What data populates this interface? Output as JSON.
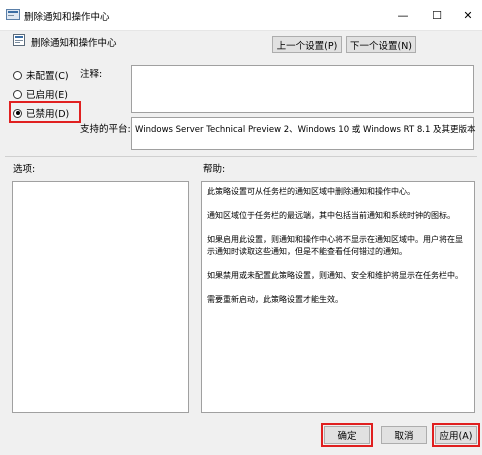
{
  "window": {
    "title": "删除通知和操作中心",
    "controls": {
      "minimize": "—",
      "maximize": "☐",
      "close": "✕"
    }
  },
  "policy": {
    "name": "删除通知和操作中心",
    "prev_label": "上一个设置(P)",
    "next_label": "下一个设置(N)"
  },
  "state": {
    "options": [
      {
        "label": "未配置(C)",
        "checked": false
      },
      {
        "label": "已启用(E)",
        "checked": false
      },
      {
        "label": "已禁用(D)",
        "checked": true
      }
    ]
  },
  "comment": {
    "label": "注释:",
    "value": ""
  },
  "platform": {
    "label": "支持的平台:",
    "value": "Windows Server Technical Preview 2、Windows 10 或 Windows RT 8.1 及其更版本"
  },
  "options_panel": {
    "label": "选项:"
  },
  "help_panel": {
    "label": "帮助:",
    "paragraphs": [
      "此策略设置可从任务栏的通知区域中删除通知和操作中心。",
      "通知区域位于任务栏的最远端，其中包括当前通知和系统时钟的图标。",
      "如果启用此设置，则通知和操作中心将不显示在通知区域中。用户将在显示通知时读取这些通知，但是不能查看任何错过的通知。",
      "如果禁用或未配置此策略设置，则通知、安全和维护将显示在任务栏中。",
      "需要重新启动，此策略设置才能生效。"
    ]
  },
  "footer": {
    "ok_label": "确定",
    "cancel_label": "取消",
    "apply_label": "应用(A)"
  },
  "colors": {
    "highlight_red": "#e02020",
    "panel_bg": "#f0f0f0"
  }
}
